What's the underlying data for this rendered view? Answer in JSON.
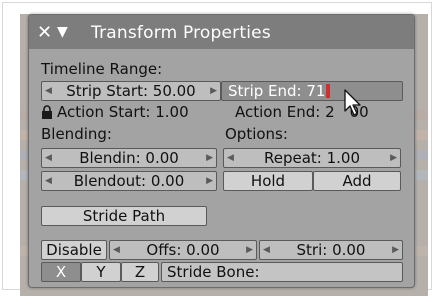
{
  "panel": {
    "title": "Transform Properties",
    "close_icon": "close-icon",
    "collapse_icon": "triangle-down-icon"
  },
  "timeline": {
    "label": "Timeline Range:",
    "strip_start": "Strip Start: 50.00",
    "strip_end": "Strip End: 71",
    "action_start": "Action Start: 1.00",
    "action_end": "Action End: 2",
    "action_end_tail": "00"
  },
  "blending": {
    "label": "Blending:",
    "blendin": "Blendin: 0.00",
    "blendout": "Blendout: 0.00"
  },
  "options": {
    "label": "Options:",
    "repeat": "Repeat: 1.00",
    "hold": "Hold",
    "add": "Add"
  },
  "stride": {
    "path_button": "Stride Path",
    "disable": "Disable",
    "offs": "Offs: 0.00",
    "stri": "Stri: 0.00",
    "x": "X",
    "y": "Y",
    "z": "Z",
    "bone": "Stride Bone:"
  },
  "colors": {
    "panel_bg": "#a3a3a3",
    "titlebar_bg": "#7d7d7d",
    "active_field": "#8e8e8e",
    "text_cursor": "#cc3030"
  }
}
